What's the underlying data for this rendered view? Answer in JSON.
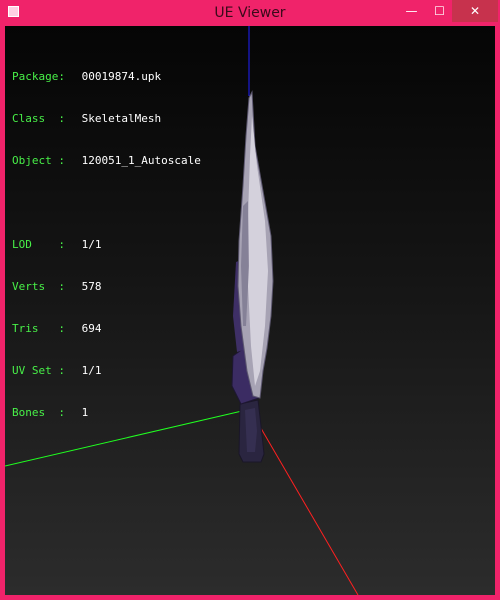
{
  "window": {
    "title": "UE Viewer"
  },
  "controls": {
    "minimize": "—",
    "maximize": "☐",
    "close": "✕"
  },
  "info": {
    "package_label": "Package:",
    "package": "00019874.upk",
    "class_label": "Class  :",
    "class": "SkeletalMesh",
    "object_label": "Object :",
    "object": "120051_1_Autoscale",
    "lod_label": "LOD    :",
    "lod": "1/1",
    "verts_label": "Verts  :",
    "verts": "578",
    "tris_label": "Tris   :",
    "tris": "694",
    "uvset_label": "UV Set :",
    "uvset": "1/1",
    "bones_label": "Bones  :",
    "bones": "1"
  },
  "colors": {
    "window_frame": "#f0236a",
    "close_button": "#c7324d",
    "label_green": "#48f048",
    "axis_x": "#ff2020",
    "axis_y": "#20ff20",
    "axis_z": "#2020ff"
  },
  "icons": [
    "app-icon",
    "minimize-icon",
    "maximize-icon",
    "close-icon"
  ]
}
